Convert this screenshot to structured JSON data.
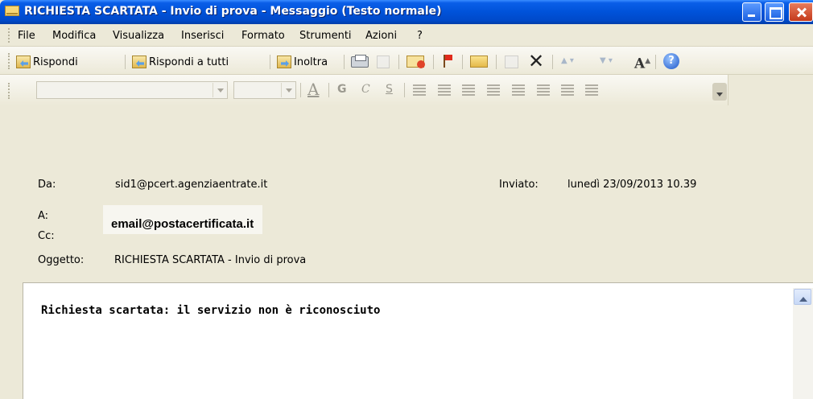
{
  "window": {
    "title": "RICHIESTA SCARTATA - Invio di prova - Messaggio (Testo normale)"
  },
  "menu": {
    "items": [
      "File",
      "Modifica",
      "Visualizza",
      "Inserisci",
      "Formato",
      "Strumenti",
      "Azioni",
      "?"
    ]
  },
  "toolbar": {
    "reply": "Rispondi",
    "reply_all": "Rispondi a tutti",
    "forward": "Inoltra",
    "delete_glyph": "✕",
    "font_glyph": "A"
  },
  "format_toolbar": {
    "font_color": "A",
    "bold": "G",
    "italic": "C",
    "underline": "S"
  },
  "header": {
    "from_label": "Da:",
    "from_value": "sid1@pcert.agenziaentrate.it",
    "sent_label": "Inviato:",
    "sent_value": "lunedì 23/09/2013 10.39",
    "to_label": "A:",
    "to_value": "email@postacertificata.it",
    "cc_label": "Cc:",
    "subject_label": "Oggetto:",
    "subject_value": "RICHIESTA SCARTATA - Invio di prova"
  },
  "body": {
    "text": "Richiesta scartata: il servizio non è riconosciuto"
  },
  "colors": {
    "titlebar": "#0052d9",
    "chrome": "#ece9d8"
  }
}
